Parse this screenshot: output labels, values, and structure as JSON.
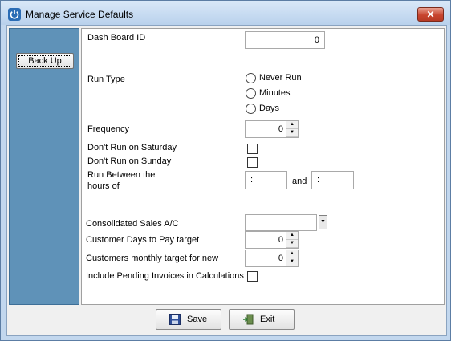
{
  "window": {
    "title": "Manage Service Defaults",
    "close_label": "✕"
  },
  "sidebar": {
    "backup_label": "Back Up"
  },
  "form": {
    "dashboard_id": {
      "label": "Dash Board ID",
      "value": "0"
    },
    "run_type": {
      "label": "Run Type",
      "options": [
        "Never Run",
        "Minutes",
        "Days"
      ],
      "selected": null
    },
    "frequency": {
      "label": "Frequency",
      "value": "0"
    },
    "dont_run_saturday": {
      "label": "Don't Run on Saturday",
      "checked": false
    },
    "dont_run_sunday": {
      "label": "Don't Run on Sunday",
      "checked": false
    },
    "run_between": {
      "label_line1": "Run Between the",
      "label_line2": "hours of",
      "from_value": ":",
      "and_label": "and",
      "to_value": ":"
    },
    "consolidated_sales": {
      "label": "Consolidated Sales A/C",
      "value": ""
    },
    "customer_days": {
      "label": "Customer Days to Pay target",
      "value": "0"
    },
    "customers_monthly": {
      "label": "Customers monthly target for new",
      "value": "0"
    },
    "include_pending": {
      "label": "Include Pending Invoices in Calculations",
      "checked": false
    }
  },
  "footer": {
    "save_label": "Save",
    "exit_label": "Exit"
  },
  "icons": {
    "app": "power-icon",
    "save": "floppy-disk-icon",
    "exit": "exit-door-icon"
  }
}
